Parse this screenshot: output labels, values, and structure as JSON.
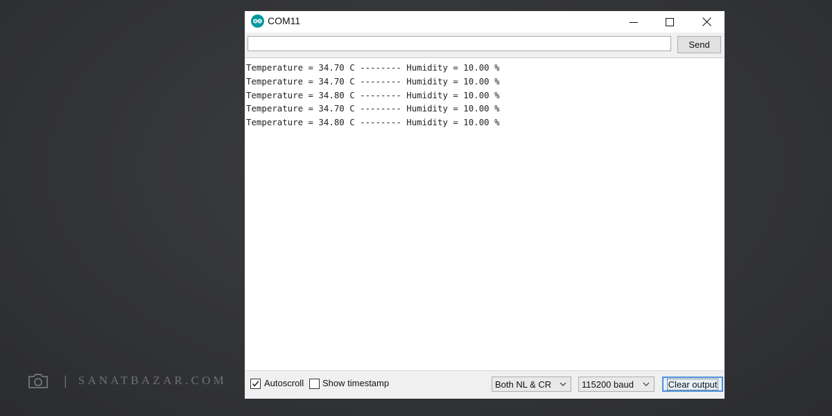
{
  "watermark": {
    "site": "SANATBAZAR.COM",
    "separator": "|"
  },
  "window": {
    "title": "COM11",
    "icon": "arduino-logo",
    "controls": {
      "minimize": "minimize-icon",
      "maximize": "maximize-icon",
      "close": "close-icon"
    }
  },
  "send_row": {
    "input_value": "",
    "send_label": "Send"
  },
  "output": {
    "lines": [
      "Temperature = 34.70 C -------- Humidity = 10.00 %",
      "Temperature = 34.70 C -------- Humidity = 10.00 %",
      "Temperature = 34.80 C -------- Humidity = 10.00 %",
      "Temperature = 34.70 C -------- Humidity = 10.00 %",
      "Temperature = 34.80 C -------- Humidity = 10.00 %"
    ]
  },
  "status_bar": {
    "autoscroll": {
      "label": "Autoscroll",
      "checked": true
    },
    "show_timestamp": {
      "label": "Show timestamp",
      "checked": false
    },
    "line_ending": "Both NL & CR",
    "baud_rate": "115200 baud",
    "clear_label": "Clear output"
  },
  "colors": {
    "arduino_teal": "#00979c",
    "focus_blue": "#4a90d9"
  }
}
